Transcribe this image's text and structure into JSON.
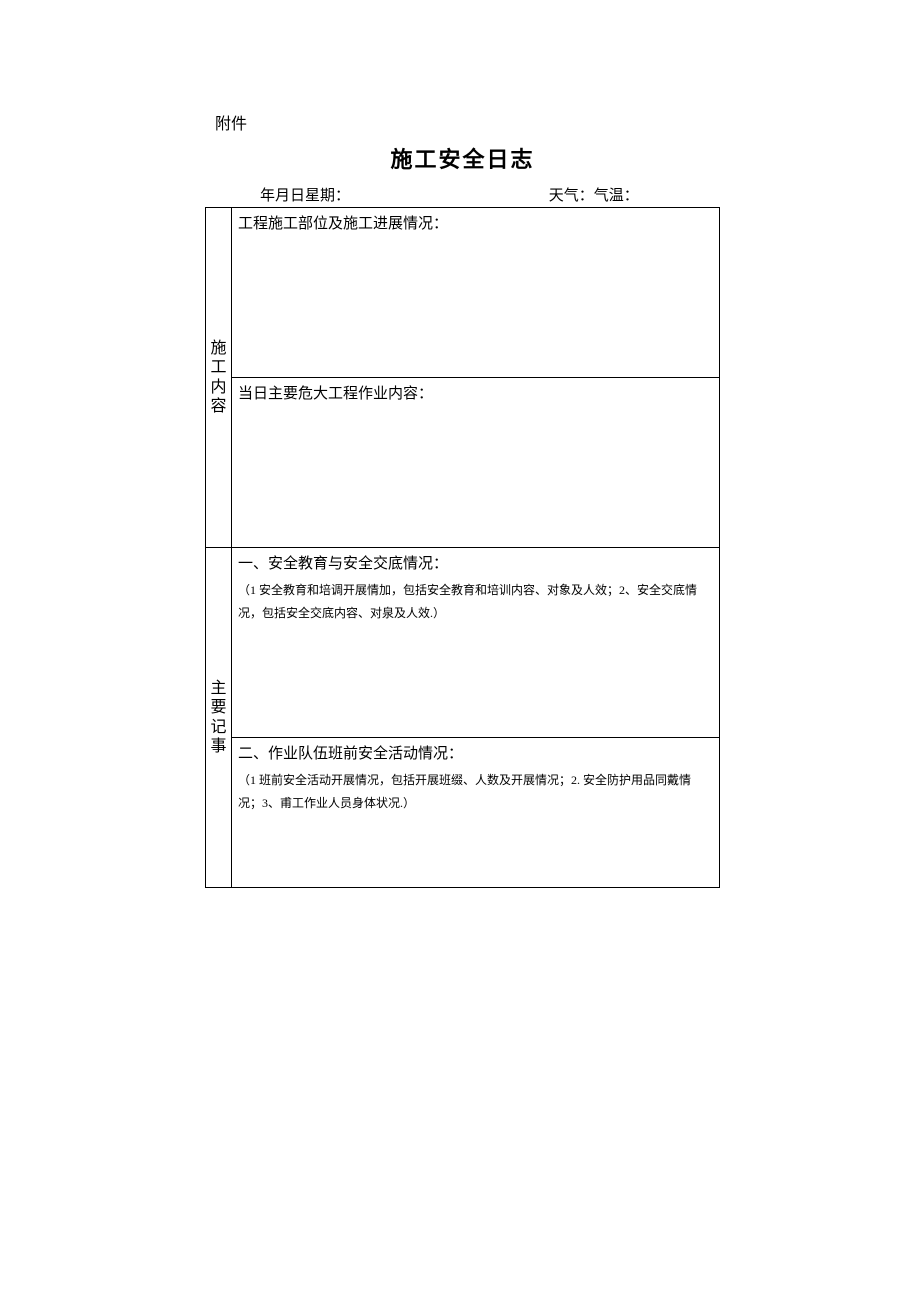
{
  "attachment_label": "附件",
  "title": "施工安全日志",
  "meta": {
    "date_label": "年月日星期：",
    "weather_label": "天气：",
    "temp_label": "气温："
  },
  "rows": {
    "construction_content_label": "施工内容",
    "progress_heading": "工程施工部位及施工进展情况：",
    "danger_heading": "当日主要危大工程作业内容：",
    "main_notes_label": "主要记事",
    "section1_heading": "一、安全教育与安全交底情况：",
    "section1_note": "（1 安全教育和培调开展情加，包括安全教育和培训内容、对象及人效；2、安全交底情况，包括安全交底内容、对泉及人效.）",
    "section2_heading": "二、作业队伍班前安全活动情况：",
    "section2_note": "（1 班前安全活动开展情况，包括开展班缀、人数及开展情况；2. 安全防护用品同戴情况；3、甫工作业人员身体状况.）"
  }
}
